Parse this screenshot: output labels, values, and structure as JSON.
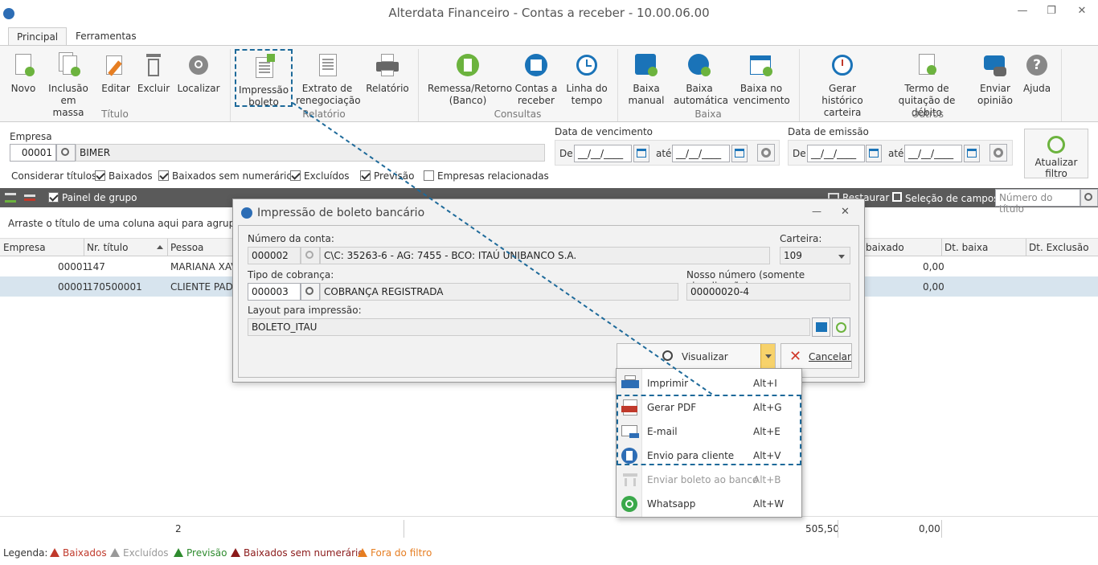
{
  "window": {
    "title": "Alterdata Financeiro - Contas a receber - 10.00.06.00"
  },
  "tabs": [
    "Principal",
    "Ferramentas"
  ],
  "ribbon": {
    "titulo": {
      "group": "Título",
      "buttons": [
        "Novo",
        "Inclusão em massa",
        "Editar",
        "Excluir",
        "Localizar"
      ]
    },
    "relatorio": {
      "group": "Relatório",
      "impressao": "Impressão boleto",
      "extrato": "Extrato de renegociação",
      "relatorio": "Relatório"
    },
    "consultas": {
      "group": "Consultas",
      "remessa": "Remessa/Retorno (Banco)",
      "contas": "Contas a receber",
      "linha": "Linha do tempo"
    },
    "baixa": {
      "group": "Baixa",
      "manual": "Baixa manual",
      "automatica": "Baixa automática",
      "vencimento": "Baixa no vencimento"
    },
    "outros": {
      "group": "Outros",
      "gerar": "Gerar histórico carteira",
      "termo": "Termo de quitação de débito",
      "enviar": "Enviar opinião",
      "ajuda": "Ajuda"
    }
  },
  "filter": {
    "empresa_label": "Empresa",
    "empresa_code": "00001",
    "empresa_name": "BIMER",
    "venc_label": "Data de vencimento",
    "emis_label": "Data de emissão",
    "de": "De",
    "ate": "até",
    "date_mask": "__/__/____",
    "considerar": "Considerar títulos:",
    "checks": [
      {
        "label": "Baixados",
        "on": true
      },
      {
        "label": "Baixados sem numerário",
        "on": true
      },
      {
        "label": "Excluídos",
        "on": true
      },
      {
        "label": "Previsão",
        "on": true
      },
      {
        "label": "Empresas relacionadas",
        "on": false
      }
    ],
    "atualizar": "Atualizar filtro"
  },
  "toolbar": {
    "painel": "Painel de grupo",
    "restaurar": "Restaurar",
    "selecao": "Seleção de campos",
    "busca_placeholder": "Número do título"
  },
  "grid": {
    "group_hint": "Arraste o título de uma coluna aqui para agrupar por",
    "columns": [
      "Empresa",
      "Nr. título",
      "Pessoa",
      "baixado",
      "Dt. baixa",
      "Dt. Exclusão"
    ],
    "rows": [
      {
        "empresa": "00001",
        "titulo": "147",
        "pessoa": "MARIANA XAV",
        "baixado": "0,00"
      },
      {
        "empresa": "00001",
        "titulo": "170500001",
        "pessoa": "CLIENTE PADR",
        "baixado": "0,00"
      }
    ],
    "footer": {
      "count": "2",
      "total": "505,50",
      "baixado": "0,00"
    }
  },
  "legend": {
    "label": "Legenda:",
    "items": [
      {
        "label": "Baixados",
        "color": "#c0392b"
      },
      {
        "label": "Excluídos",
        "color": "#999999"
      },
      {
        "label": "Previsão",
        "color": "#2e8b2e"
      },
      {
        "label": "Baixados sem numerário",
        "color": "#8b1a1a"
      },
      {
        "label": "Fora do filtro",
        "color": "#e67e22"
      }
    ]
  },
  "dialog": {
    "title": "Impressão de boleto bancário",
    "conta_label": "Número da conta:",
    "conta_code": "000002",
    "conta_desc": "C\\C: 35263-6 - AG: 7455 - BCO: ITAÚ UNIBANCO S.A.",
    "carteira_label": "Carteira:",
    "carteira": "109",
    "tipo_label": "Tipo de cobrança:",
    "tipo_code": "000003",
    "tipo_desc": "COBRANÇA REGISTRADA",
    "nosso_label": "Nosso número (somente visualização):",
    "nosso": "00000020-4",
    "layout_label": "Layout para impressão:",
    "layout": "BOLETO_ITAU",
    "visualizar": "Visualizar",
    "cancelar": "Cancelar"
  },
  "menu": [
    {
      "label": "Imprimir",
      "key": "Alt+I",
      "enabled": true
    },
    {
      "label": "Gerar PDF",
      "key": "Alt+G",
      "enabled": true
    },
    {
      "label": "E-mail",
      "key": "Alt+E",
      "enabled": true
    },
    {
      "label": "Envio para cliente",
      "key": "Alt+V",
      "enabled": true
    },
    {
      "label": "Enviar boleto ao banco",
      "key": "Alt+B",
      "enabled": false
    },
    {
      "label": "Whatsapp",
      "key": "Alt+W",
      "enabled": true
    }
  ]
}
